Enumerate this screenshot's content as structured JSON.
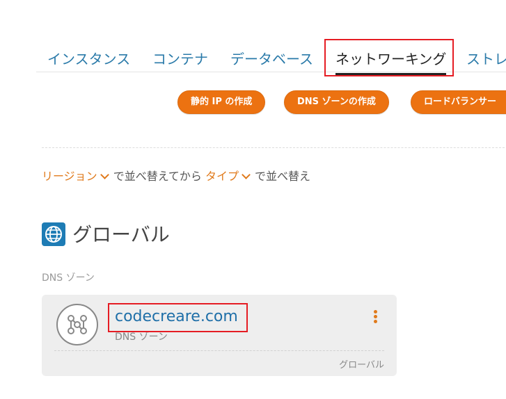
{
  "tabs": [
    "インスタンス",
    "コンテナ",
    "データベース",
    "ネットワーキング",
    "ストレ"
  ],
  "active_tab": "ネットワーキング",
  "actions": {
    "static_ip": "静的 IP の作成",
    "dns_zone": "DNS ゾーンの作成",
    "load_balancer": "ロードバランサー"
  },
  "sort": {
    "region": "リージョン",
    "text1": "で並べ替えてから",
    "type": "タイプ",
    "text2": "で並べ替え"
  },
  "section": {
    "title": "グローバル",
    "group_label": "DNS ゾーン"
  },
  "card": {
    "title": "codecreare.com",
    "subtitle": "DNS ゾーン",
    "footer": "グローバル"
  },
  "icons": {
    "section": "globe-icon",
    "card": "dns-zone-icon",
    "menu": "more-vertical-icon"
  },
  "colors": {
    "accent": "#ec7211",
    "link": "#1f6fa8",
    "highlight_box": "#e51c23"
  }
}
